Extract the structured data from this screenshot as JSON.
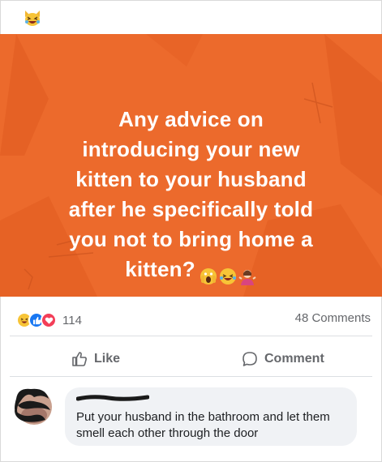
{
  "post": {
    "text": "Any advice on\nintroducing your new\nkitten to your husband\nafter he specifically told\nyou not to bring home a\nkitten?",
    "background_color": "#ec6a2c",
    "text_color": "#ffffff",
    "inline_emojis": [
      "scream-face-icon",
      "laughing-tears-icon",
      "woman-shrugging-icon"
    ]
  },
  "header": {
    "emoji": "laughing-cat-icon"
  },
  "reactions": {
    "icons": [
      "haha-reaction-icon",
      "like-reaction-icon",
      "love-reaction-icon"
    ],
    "count": "114",
    "comments": "48 Comments"
  },
  "actions": {
    "like": "Like",
    "comment": "Comment"
  },
  "comment": {
    "text": "Put your husband in the bathroom and let them smell each other through the door",
    "bubble_color": "#f0f2f5"
  }
}
